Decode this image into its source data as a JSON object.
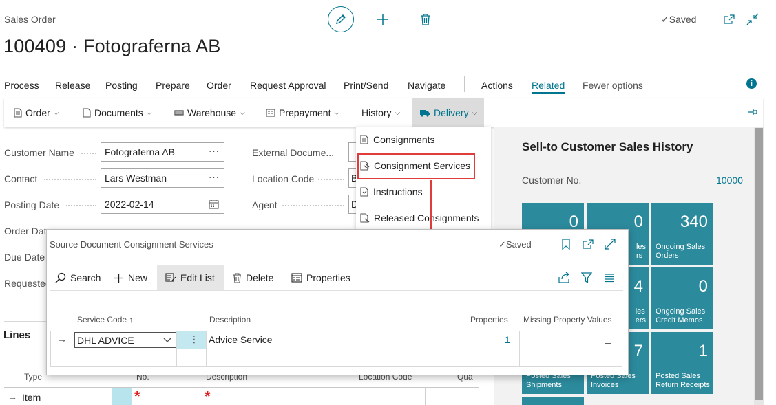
{
  "header": {
    "page_kind": "Sales Order",
    "title": "100409 · Fotograferna AB",
    "saved": "Saved"
  },
  "action_bar": [
    "Process",
    "Release",
    "Posting",
    "Prepare",
    "Order",
    "Request Approval",
    "Print/Send",
    "Navigate",
    "Actions",
    "Related",
    "Fewer options"
  ],
  "sub_bar": [
    "Order",
    "Documents",
    "Warehouse",
    "Prepayment",
    "History",
    "Delivery"
  ],
  "form": {
    "customer_name_label": "Customer Name",
    "customer_name": "Fotograferna AB",
    "contact_label": "Contact",
    "contact": "Lars Westman",
    "posting_date_label": "Posting Date",
    "posting_date": "2022-02-14",
    "order_date_label": "Order Dat",
    "due_date_label": "Due Date",
    "requested_label": "Requested",
    "external_doc_label": "External Docume...",
    "location_code_label": "Location Code",
    "location_partial": "B",
    "agent_label": "Agent",
    "agent_partial": "D"
  },
  "delivery_menu": [
    "Consignments",
    "Consignment Services",
    "Instructions",
    "Released Consignments"
  ],
  "factbox": {
    "title": "Sell-to Customer Sales History",
    "customer_no_label": "Customer No.",
    "customer_no": "10000",
    "tiles": [
      {
        "value": "0",
        "label": ""
      },
      {
        "value": "0",
        "label": "les\nrs"
      },
      {
        "value": "340",
        "label": "Ongoing Sales\nOrders"
      },
      {
        "value": "",
        "label": ""
      },
      {
        "value": "4",
        "label": "les\ners"
      },
      {
        "value": "0",
        "label": "Ongoing Sales\nCredit Memos"
      },
      {
        "value": "",
        "label": "Posted Sales\nShipments"
      },
      {
        "value": "7",
        "label": "Posted Sales\nInvoices"
      },
      {
        "value": "1",
        "label": "Posted Sales\nReturn Receipts"
      }
    ]
  },
  "lines": {
    "title": "Lines",
    "columns": [
      "Type",
      "No.",
      "Description",
      "Location Code",
      "Qua"
    ],
    "row_type": "Item",
    "required_mark": "*"
  },
  "modal": {
    "title": "Source Document Consignment Services",
    "saved": "Saved",
    "toolbar": [
      "Search",
      "New",
      "Edit List",
      "Delete",
      "Properties"
    ],
    "columns": {
      "service_code": "Service Code",
      "sort_indicator": "↑",
      "description": "Description",
      "properties": "Properties",
      "missing": "Missing Property Values"
    },
    "row": {
      "service_code": "DHL ADVICE",
      "description": "Advice Service",
      "properties": "1",
      "missing": "_"
    }
  },
  "colors": {
    "accent": "#00758f",
    "tile": "#2b8a9c",
    "highlight": "#e03c3c"
  }
}
